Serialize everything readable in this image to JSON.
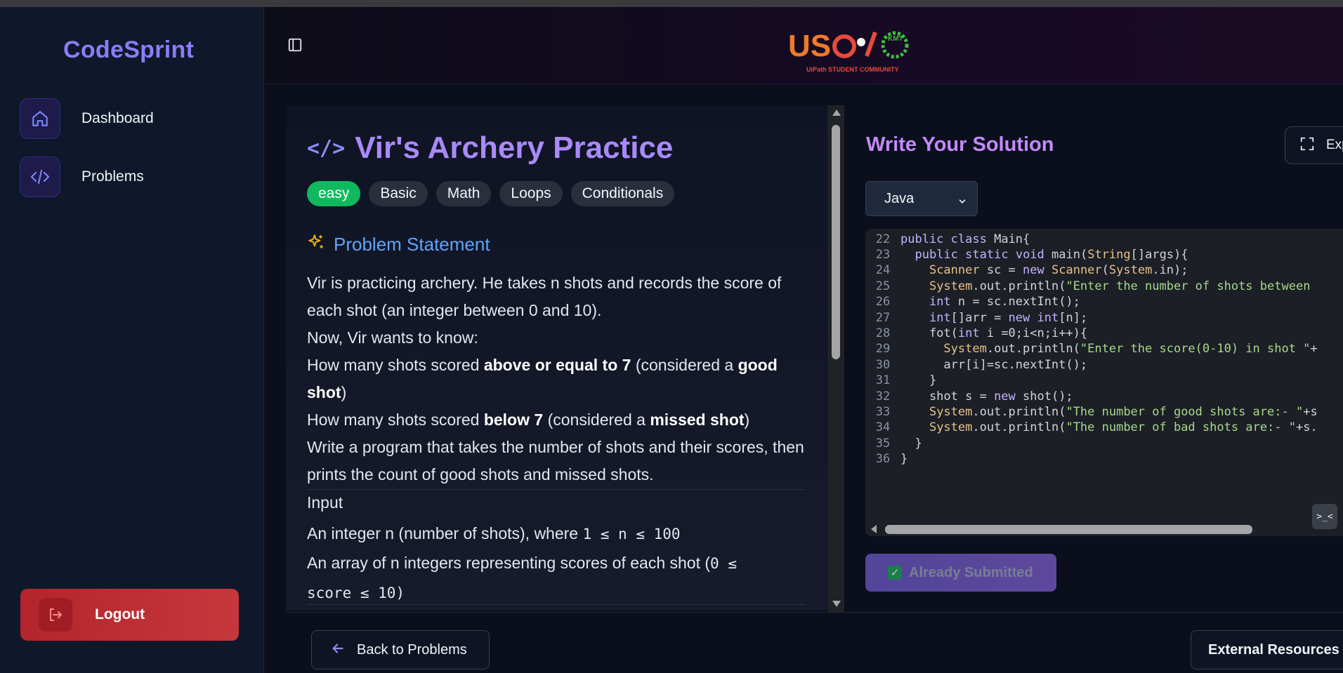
{
  "app": {
    "brand": "CodeSprint",
    "logo_text": "UiPath STUDENT COMMUNITY"
  },
  "sidebar": {
    "items": [
      {
        "label": "Dashboard",
        "icon": "home-icon"
      },
      {
        "label": "Problems",
        "icon": "code-icon"
      }
    ],
    "logout_label": "Logout"
  },
  "problem": {
    "title_icon": "</>",
    "title": "Vir's Archery Practice",
    "tags": [
      "easy",
      "Basic",
      "Math",
      "Loops",
      "Conditionals"
    ],
    "section_title": "Problem Statement",
    "statement": {
      "p1": "Vir is practicing archery. He takes n shots and records the score of each shot (an integer between 0 and 10).",
      "p2": "Now, Vir wants to know:",
      "p3a": "How many shots scored ",
      "p3b": "above or equal to 7",
      "p3c": " (considered a ",
      "p3d": "good shot",
      "p3e": ")",
      "p4a": "How many shots scored ",
      "p4b": "below 7",
      "p4c": " (considered a ",
      "p4d": "missed shot",
      "p4e": ")",
      "p5": "Write a program that takes the number of shots and their scores, then prints the count of good shots and missed shots."
    },
    "input_head": "Input",
    "input_line1_text": "An integer n (number of shots), where ",
    "input_line1_code": "1 ≤ n ≤ 100",
    "input_line2_text": "An array of n integers representing scores of each shot (",
    "input_line2_code_a": "0 ≤",
    "input_line2_code_b": "score ≤ 10",
    "input_line2_end": ")"
  },
  "solution": {
    "title": "Write Your Solution",
    "expand_label": "Exp",
    "language": "Java",
    "submit_label": "Already Submitted",
    "code_lines": [
      {
        "n": "22",
        "text": "public class Main{"
      },
      {
        "n": "23",
        "text": "  public static void main(String[]args){"
      },
      {
        "n": "24",
        "text": "    Scanner sc = new Scanner(System.in);"
      },
      {
        "n": "25",
        "text": "    System.out.println(\"Enter the number of shots between"
      },
      {
        "n": "26",
        "text": "    int n = sc.nextInt();"
      },
      {
        "n": "27",
        "text": "    int[]arr = new int[n];"
      },
      {
        "n": "28",
        "text": "    fot(int i =0;i<n;i++){"
      },
      {
        "n": "29",
        "text": "      System.out.println(\"Enter the score(0-10) in shot \"+"
      },
      {
        "n": "30",
        "text": "      arr[i]=sc.nextInt();"
      },
      {
        "n": "31",
        "text": "    }"
      },
      {
        "n": "32",
        "text": "    shot s = new shot();"
      },
      {
        "n": "33",
        "text": "    System.out.println(\"The number of good shots are:- \"+s"
      },
      {
        "n": "34",
        "text": "    System.out.println(\"The number of bad shots are:- \"+s."
      },
      {
        "n": "35",
        "text": "  }"
      },
      {
        "n": "36",
        "text": "}"
      }
    ]
  },
  "footer": {
    "back_label": "Back to Problems",
    "external_label": "External Resources"
  },
  "colors": {
    "accent": "#a98af7",
    "easy": "#10b95e",
    "logout": "#c6373c"
  }
}
